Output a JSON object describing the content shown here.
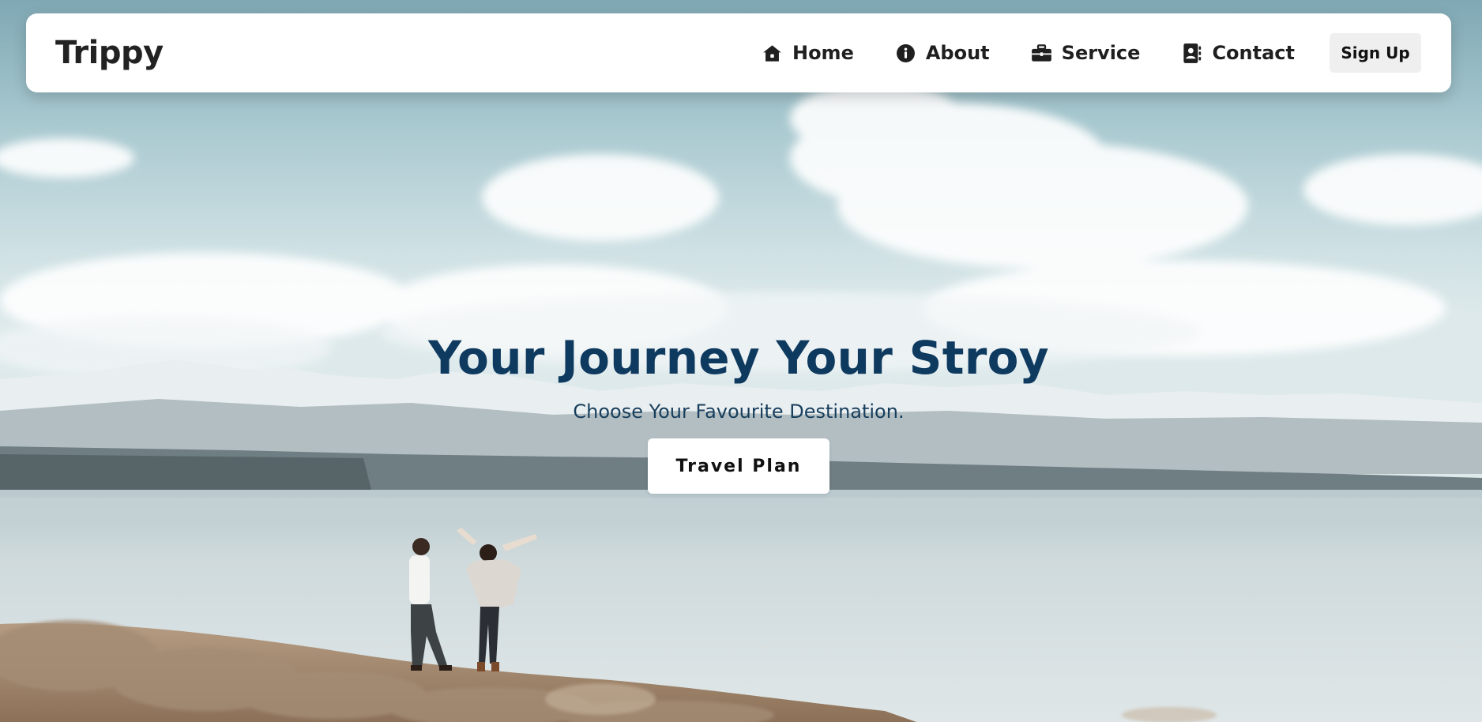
{
  "navbar": {
    "logo": "Trippy",
    "links": [
      {
        "label": "Home",
        "icon": "home-icon"
      },
      {
        "label": "About",
        "icon": "info-icon"
      },
      {
        "label": "Service",
        "icon": "briefcase-icon"
      },
      {
        "label": "Contact",
        "icon": "address-book-icon"
      }
    ],
    "signup_label": "Sign Up"
  },
  "hero": {
    "title": "Your Journey Your Stroy",
    "subtitle": "Choose Your Favourite Destination.",
    "cta_label": "Travel Plan"
  },
  "colors": {
    "title": "#0f3a5f",
    "subtitle": "#173e5c",
    "navbar_bg": "#ffffff",
    "signup_bg": "#efefef"
  }
}
